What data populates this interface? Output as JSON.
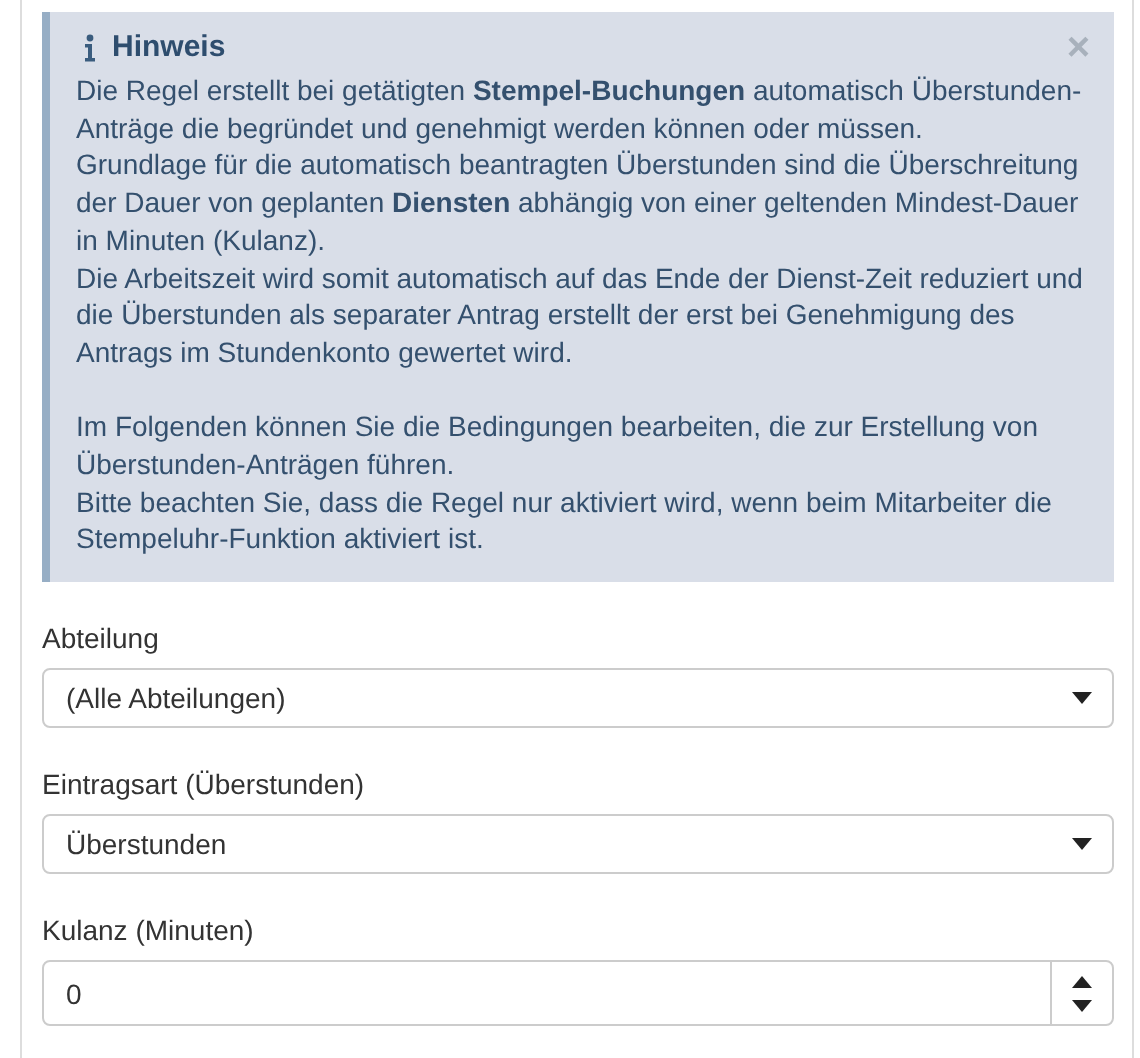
{
  "alert": {
    "title": "Hinweis",
    "close": "×",
    "groups": [
      [
        "Die Regel erstellt bei getätigten **Stempel-Buchungen** automatisch Überstunden-Anträge die begründet und genehmigt werden können oder müssen.",
        "Grundlage für die automatisch beantragten Überstunden sind die Überschreitung der Dauer von geplanten **Diensten** abhängig von einer geltenden Mindest-Dauer in Minuten (Kulanz).",
        "Die Arbeitszeit wird somit automatisch auf das Ende der Dienst-Zeit reduziert und die Überstunden als separater Antrag erstellt der erst bei Genehmigung des Antrags im Stundenkonto gewertet wird."
      ],
      [
        "Im Folgenden können Sie die Bedingungen bearbeiten, die zur Erstellung von Überstunden-Anträgen führen.",
        "Bitte beachten Sie, dass die Regel nur aktiviert wird, wenn beim Mitarbeiter die Stempeluhr-Funktion aktiviert ist."
      ]
    ]
  },
  "fields": [
    {
      "kind": "select",
      "label": "Abteilung",
      "value": "(Alle Abteilungen)"
    },
    {
      "kind": "select",
      "label": "Eintragsart (Überstunden)",
      "value": "Überstunden"
    },
    {
      "kind": "number",
      "label": "Kulanz (Minuten)",
      "value": "0"
    }
  ]
}
